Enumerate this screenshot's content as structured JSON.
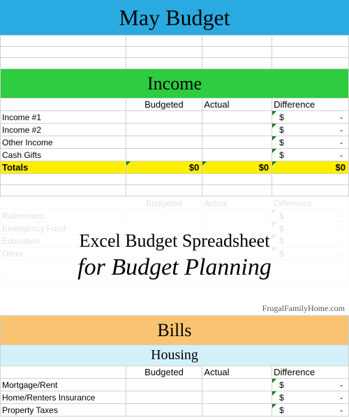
{
  "title": "May Budget",
  "columns": {
    "budgeted": "Budgeted",
    "actual": "Actual",
    "difference": "Difference"
  },
  "income": {
    "heading": "Income",
    "rows": [
      "Income #1",
      "Income #2",
      "Other Income",
      "Cash Gifts"
    ],
    "diff_symbol": "$",
    "diff_dash": "-",
    "totals_label": "Totals",
    "totals_budgeted": "$0",
    "totals_actual": "$0",
    "totals_diff": "$0"
  },
  "overlay": {
    "line1": "Excel Budget Spreadsheet",
    "line2": "for Budget Planning",
    "credit": "FrugalFamilyHome.com"
  },
  "faded": {
    "rows": [
      "Retirement",
      "Emergency Fund",
      "Education",
      "Other"
    ]
  },
  "bills": {
    "heading": "Bills",
    "housing_heading": "Housing",
    "rows": [
      "Mortgage/Rent",
      "Home/Renters Insurance",
      "Property Taxes"
    ]
  }
}
